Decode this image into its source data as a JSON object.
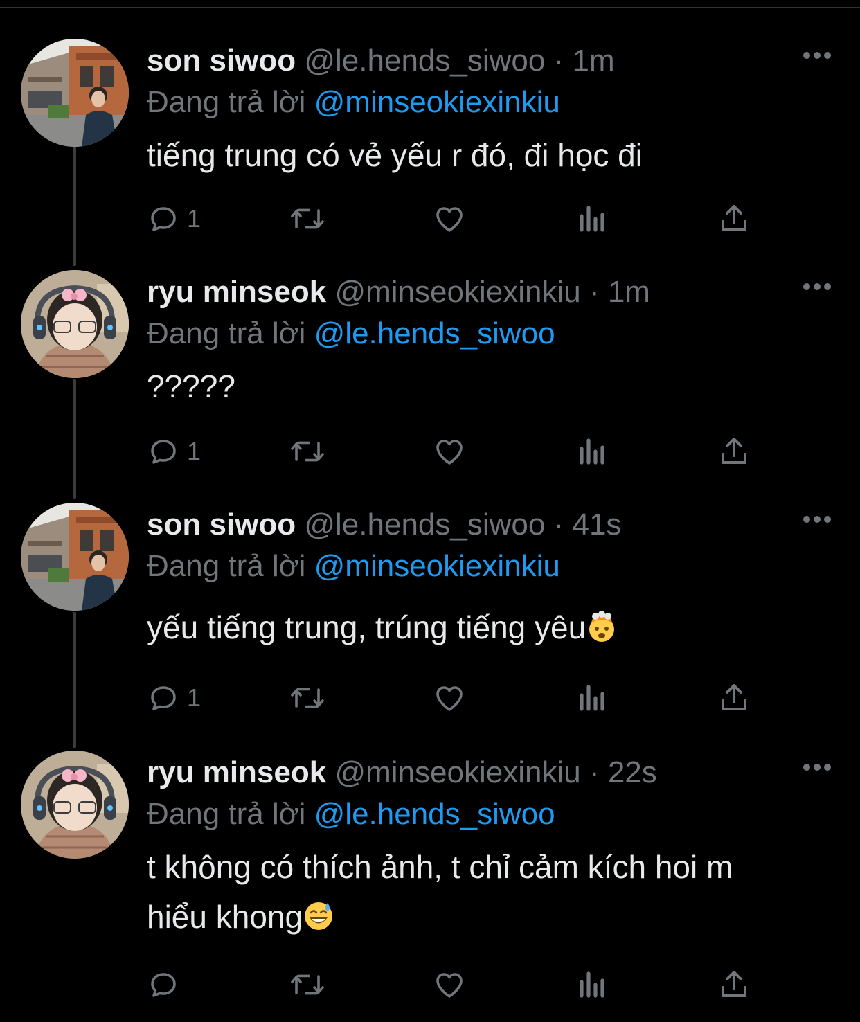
{
  "colors": {
    "background": "#000000",
    "primary_text": "#e7e9ea",
    "secondary_text": "#71767b",
    "accent": "#1d9bf0",
    "thread_line": "#3a3d40"
  },
  "tweets": [
    {
      "display_name": "son siwoo",
      "handle": "@le.hends_siwoo",
      "separator": "·",
      "time": "1m",
      "reply_prefix": "Đang trả lời",
      "reply_to": "@minseokiexinkiu",
      "text": "tiếng trung có vẻ yếu r đó, đi học đi",
      "emoji": "",
      "reply_count": "1",
      "avatar": "photo-avatar-street"
    },
    {
      "display_name": "ryu minseok",
      "handle": "@minseokiexinkiu",
      "separator": "·",
      "time": "1m",
      "reply_prefix": "Đang trả lời",
      "reply_to": "@le.hends_siwoo",
      "text": "?????",
      "emoji": "",
      "reply_count": "1",
      "avatar": "photo-avatar-headset"
    },
    {
      "display_name": "son siwoo",
      "handle": "@le.hends_siwoo",
      "separator": "·",
      "time": "41s",
      "reply_prefix": "Đang trả lời",
      "reply_to": "@minseokiexinkiu",
      "text": "yếu tiếng trung, trúng tiếng yêu",
      "emoji": "exploding-head-emoji",
      "reply_count": "1",
      "avatar": "photo-avatar-street"
    },
    {
      "display_name": "ryu minseok",
      "handle": "@minseokiexinkiu",
      "separator": "·",
      "time": "22s",
      "reply_prefix": "Đang trả lời",
      "reply_to": "@le.hends_siwoo",
      "text_line1": "t không có thích ảnh, t chỉ cảm kích hoi m",
      "text_line2": "hiểu khong",
      "emoji": "grinning-sweat-emoji",
      "reply_count": "",
      "avatar": "photo-avatar-headset"
    }
  ],
  "action_icons": [
    "reply-icon",
    "retweet-icon",
    "like-icon",
    "views-icon",
    "share-icon"
  ],
  "more_icon": "more-options-icon"
}
